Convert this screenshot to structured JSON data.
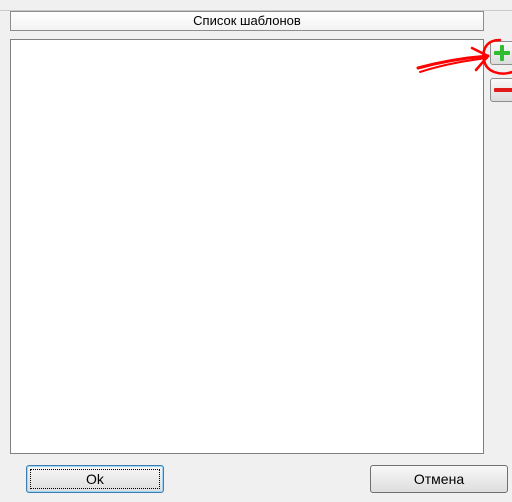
{
  "dialog": {
    "list_header": "Список шаблонов",
    "items": []
  },
  "side_buttons": {
    "add_icon": "plus-icon",
    "remove_icon": "minus-icon"
  },
  "buttons": {
    "ok_label": "Ok",
    "cancel_label": "Отмена"
  },
  "colors": {
    "add": "#2ebd2e",
    "remove": "#e01919",
    "annotation": "#ff0000"
  }
}
